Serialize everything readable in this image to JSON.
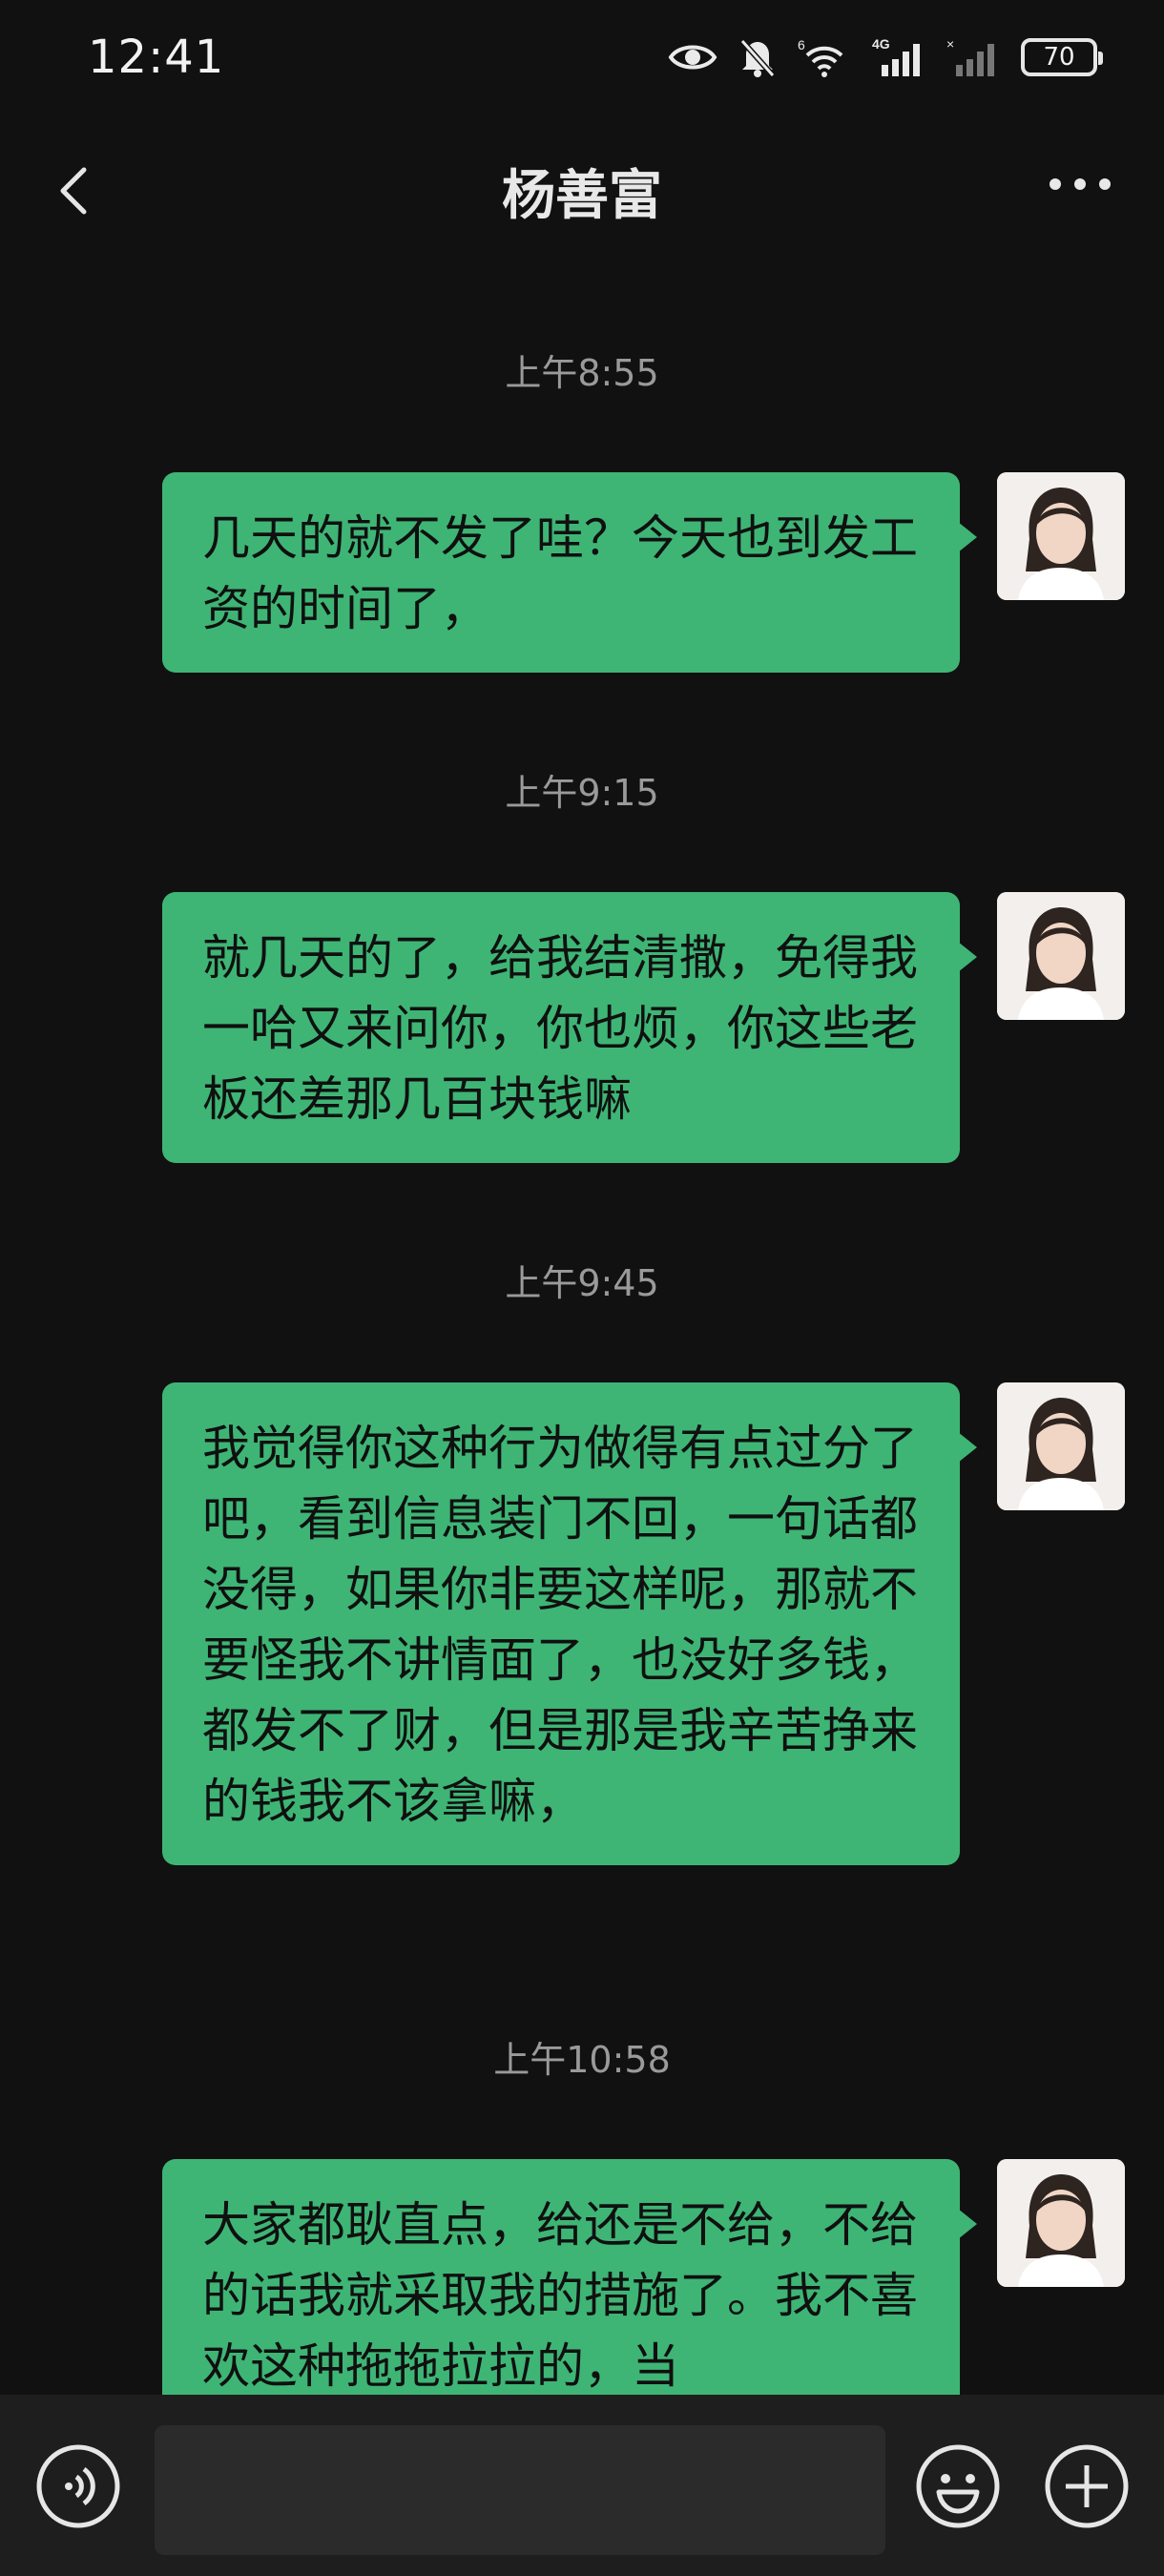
{
  "status_bar": {
    "time": "12:41",
    "battery": "70",
    "icons": [
      "eye-icon",
      "bell-muted-icon",
      "wifi-6-icon",
      "signal-4g-icon",
      "signal-no-service-icon",
      "battery-icon"
    ]
  },
  "nav": {
    "title": "杨善富",
    "back_icon": "chevron-left-icon",
    "more_icon": "more-dots-icon"
  },
  "messages": [
    {
      "time": "上午8:55",
      "text": "几天的就不发了哇？今天也到发工资的时间了，"
    },
    {
      "time": "上午9:15",
      "text": "就几天的了，给我结清撒，免得我一哈又来问你，你也烦，你这些老板还差那几百块钱嘛"
    },
    {
      "time": "上午9:45",
      "text": "我觉得你这种行为做得有点过分了吧，看到信息装门不回，一句话都没得，如果你非要这样呢，那就不要怪我不讲情面了，也没好多钱，都发不了财，但是那是我辛苦挣来的钱我不该拿嘛，"
    },
    {
      "time": "上午10:58",
      "text": "大家都耿直点，给还是不给，不给的话我就采取我的措施了。我不喜欢这种拖拖拉拉的，当"
    }
  ],
  "input_bar": {
    "voice_icon": "voice-icon",
    "emoji_icon": "emoji-icon",
    "plus_icon": "plus-icon",
    "text_value": ""
  },
  "colors": {
    "background": "#111111",
    "bubble": "#3eb575",
    "input_bar": "#1e1e1e"
  }
}
